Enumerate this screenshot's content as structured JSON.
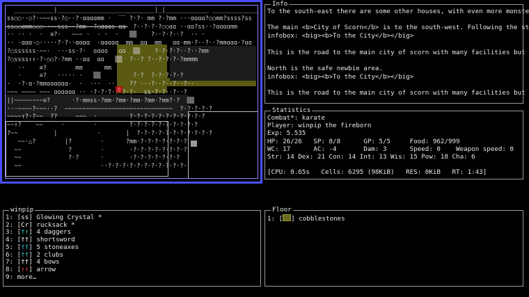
{
  "map": {
    "rows": [
      "  ___________|___________________________|_|____________ ________________________",
      "ss○○··○?·~~~ss·?○··?·ɑɑɑɑmm ·  ‾‾ ?·?· mm ?·?mm ···ɑɑɑɑ?○○mm?ssss?ss",
      "ss○○ɑmm○○○··~~sss··?mm··?○ɑɑɑs ɑɑ  ?··?·?·?○○ɑɑ ··ɑɑ?ss··?ɑɑɑɑmm",
      "·· ·· ·  ·  ≡?·   ~~~ ·  · ·  ·   ▒▒    ?··?·?··?  ·· ·",
      "·· ·ɑɑɑ·○·····?·?··ɑɑɑɑ  ·ɑɑɑɑɑ  mm  ɑɑ  mm   ɑɑ·mm·?··?··?mmɑɑɑ·?ɑɑ",
      "?○ssssss·~~·  ···ss·?·  ɑɑɑɑ   ɑɑ  ▒▒    ?·?·?·?··?··?mm",
      "?○ssss↑↑·?·○○?·?mm ··ɑɑ  ɑɑ   ▒▒  ?··? ?··?·?·?·?mmmm",
      "   ··    ≡?        mm      mm            ",
      "   ·     ≡?   ····· ·   ▒▒         ?·?  ?·?·?·?·?",
      "·  ·?·ɑ·?mmɑɑɑɑɑɑ·  ·  ···  ··    ?? ···?··?··?··?··",
      "~~~ ~~~~ ~~~ ɑɑɑɑɑɑ ·· ·?·?·?·?·?·?·  ss·?·?··?··?",
      "||~~~~~~~~≡?      ·?·mmss·?mm·?mm·?mm·?mm·?mm?·?  ▒▒",
      "···~~~~?~~~··?  ~~~~~~~~~~~~~~~~~~~~~~~~~~~~~~  ?·?·?·?·?",
      "~~~~↑?·?~~  ??     ~~~  ·         ?·?·?·?·?·?·?·?·?·?·?",
      "~~↑?    ~~     ·        ·         ?·?·?·?·?·?·?·?·?·?",
      "?~~          |           ·       |  ?·?·?·?·?·?·?·?·?·?·?",
      "   ~~·△?        |?        ·      ?mm·?·?·?·?·?·?·?",
      "  ~~             ?        ·       ·?·?·?·?·?·?·?·?",
      "  ~~             ?·?      ·       ·?·?·?·?·?·?·?",
      "  ~~                      ··?·?·?·?·?·?·?·?·?·?·?·"
    ]
  },
  "info": {
    "title": "Info",
    "lines": [
      "To the south-east there are some other houses, with even more monsters",
      "",
      "The main <b>City of Scorn</b> is to the south-west. Following the stre",
      "infobox: <big><b>To the City</b></big>",
      "",
      "This is the road to the main city of scorn with many facilities but al",
      "",
      "North is the safe newbie area.",
      "infobox: <big><b>To the City</b></big>",
      "",
      "This is the road to the main city of scorn with many facilities but al"
    ]
  },
  "stats": {
    "title": "Statistics",
    "lines": [
      "Combat*: karate",
      "Player: winpip the fireborn",
      "Exp: 5.535",
      "HP: 26/26   SP: 8/8      GP: 5/5     Food: 962/999",
      "WC: 17      AC: -4       Dam: 3      Speed: 0    Weapon speed: 0",
      "Str: 14 Dex: 21 Con: 14 Int: 13 Wis: 15 Pow: 18 Cha: 6",
      "",
      "[CPU: 0.65s   Cells: 6295 (98KiB)   RES: 0KiB   RT: 1:43]"
    ]
  },
  "inventory": {
    "title": "winpip",
    "items": [
      {
        "num": "1:",
        "glyph": "ss",
        "glyph_color": "#ffffff",
        "label": "Glowing Crystal *"
      },
      {
        "num": "2:",
        "glyph": "Cr",
        "glyph_color": "#ffffff",
        "label": "rucksack *"
      },
      {
        "num": "3:",
        "glyph": "†↑",
        "glyph_color": "#33cccc",
        "label": "4 daggers"
      },
      {
        "num": "4:",
        "glyph": "††",
        "glyph_color": "#ffffff",
        "label": "shortsword"
      },
      {
        "num": "5:",
        "glyph": "††",
        "glyph_color": "#33cccc",
        "label": "5 stoneaxes"
      },
      {
        "num": "6:",
        "glyph": "††",
        "glyph_color": "#33cccc",
        "label": "2 clubs"
      },
      {
        "num": "7:",
        "glyph": "††",
        "glyph_color": "#ffffff",
        "label": "4 bows"
      },
      {
        "num": "8:",
        "glyph": "↑↑",
        "glyph_color": "#ff4444",
        "label": "arrow"
      }
    ],
    "more": "9: more…"
  },
  "floor": {
    "title": "Floor",
    "items": [
      {
        "num": "1:",
        "glyph_color": "#6a6a20",
        "label": "cobblestones"
      }
    ]
  }
}
